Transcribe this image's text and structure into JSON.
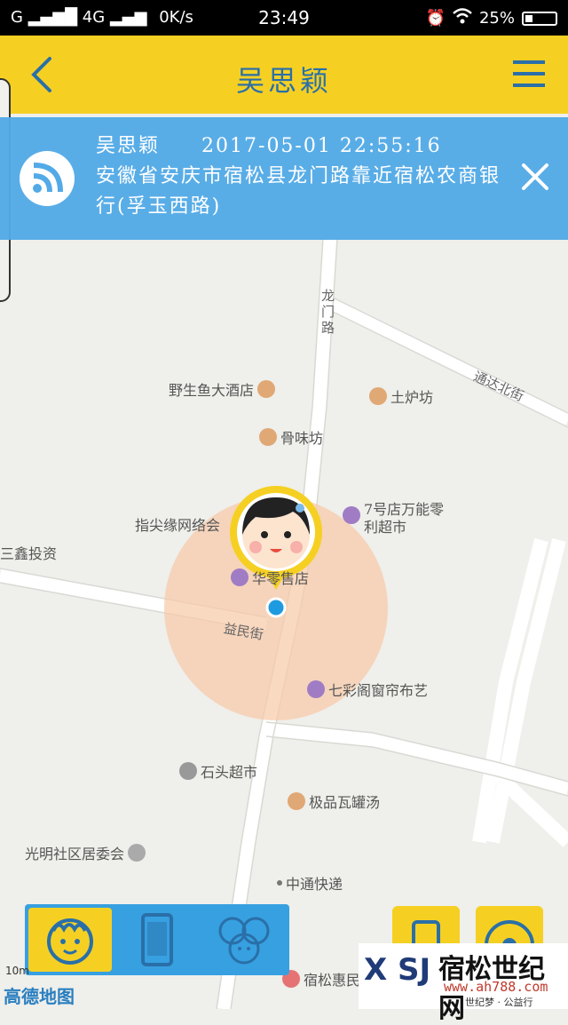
{
  "status_bar": {
    "network": "G",
    "network2": "4G",
    "speed": "0K/s",
    "time": "23:49",
    "battery": "25%",
    "battery_level": 0.25
  },
  "app_bar": {
    "title": "吴思颖"
  },
  "info": {
    "name": "吴思颖",
    "datetime": "2017-05-01 22:55:16",
    "address": "安徽省安庆市宿松县龙门路靠近宿松农商银行(孚玉西路)"
  },
  "map": {
    "pois": [
      {
        "name": "野生鱼大酒店",
        "icon": "restaurant-icon"
      },
      {
        "name": "土炉坊",
        "icon": "restaurant-icon"
      },
      {
        "name": "骨味坊",
        "icon": "restaurant-icon"
      },
      {
        "name": "指尖缘网络会",
        "icon": "venue-icon"
      },
      {
        "name": "7号店万能零",
        "name2": "利超市",
        "icon": "shop-icon"
      },
      {
        "name": "三鑫投资",
        "icon": "none"
      },
      {
        "name": "华零售店",
        "icon": "shop-icon"
      },
      {
        "name": "七彩阁窗帘布艺",
        "icon": "shop-icon"
      },
      {
        "name": "石头超市",
        "icon": "supermarket-icon"
      },
      {
        "name": "极品瓦罐汤",
        "icon": "restaurant-icon"
      },
      {
        "name": "光明社区居委会",
        "icon": "government-icon"
      },
      {
        "name": "中通快递",
        "icon": "dot-icon"
      },
      {
        "name": "宿松惠民",
        "icon": "hospital-icon"
      }
    ],
    "roads": {
      "longmen": "龙门路",
      "tongda": "通达北街",
      "yimin": "益民街"
    },
    "scale": "10m",
    "logo": "高德地图"
  },
  "watermark": {
    "brand": "宿松世纪网",
    "mark": "X SJ",
    "site": "www.ah788.com",
    "slogan": "世纪梦 · 公益行"
  },
  "colors": {
    "accent_yellow": "#f5d023",
    "title_blue": "#2a6fa8",
    "info_blue": "#52aae6",
    "location_dot": "#1e9be0",
    "accuracy_circle": "#f8c9a6"
  }
}
